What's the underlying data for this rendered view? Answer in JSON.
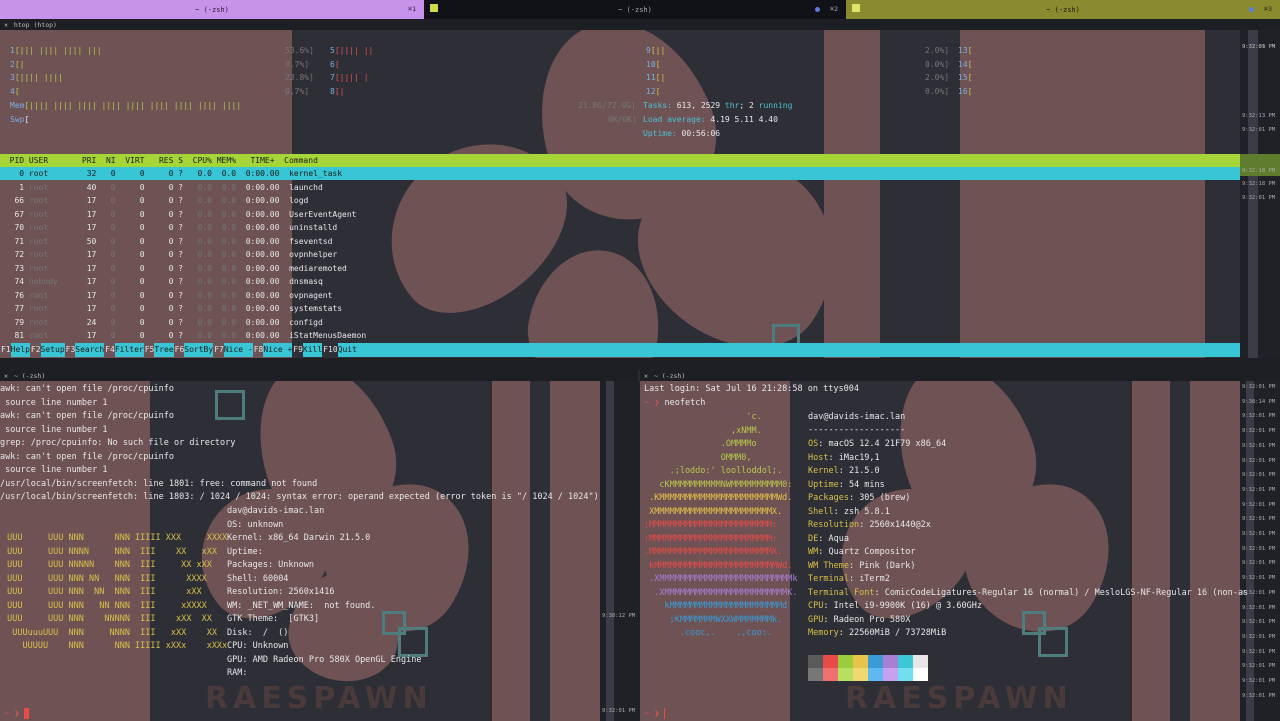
{
  "tabs": [
    {
      "title": "~ (-zsh)",
      "shortcut": "⌘1",
      "color": "#c792ea"
    },
    {
      "title": "~ (-zsh)",
      "shortcut": "⌘2",
      "color": "#111217"
    },
    {
      "title": "~ (-zsh)",
      "shortcut": "⌘3",
      "color": "#8a8a2e"
    }
  ],
  "htop": {
    "pane_title": "htop (htop)",
    "cpus_left": [
      {
        "n": "1",
        "bar": "[||| |||| |||| |||",
        "pct": "53.6"
      },
      {
        "n": "2",
        "bar": "[|",
        "pct": "0.7"
      },
      {
        "n": "3",
        "bar": "[|||| ||||",
        "pct": "23.8"
      },
      {
        "n": "4",
        "bar": "[",
        "pct": "0.7"
      }
    ],
    "cpus_mid": [
      {
        "n": "5",
        "bar": "[|||| ||"
      },
      {
        "n": "6",
        "bar": "["
      },
      {
        "n": "7",
        "bar": "[|||| |"
      },
      {
        "n": "8",
        "bar": "[|"
      }
    ],
    "cpus_mid2": [
      {
        "n": "9",
        "bar": "[||",
        "pct": "2.0"
      },
      {
        "n": "10",
        "bar": "[",
        "pct": "0.0"
      },
      {
        "n": "11",
        "bar": "[|",
        "pct": "2.0"
      },
      {
        "n": "12",
        "bar": "[",
        "pct": "0.0"
      }
    ],
    "cpus_right": [
      {
        "n": "13",
        "bar": "["
      },
      {
        "n": "14",
        "bar": "["
      },
      {
        "n": "15",
        "bar": "["
      },
      {
        "n": "16",
        "bar": "["
      }
    ],
    "mem_label": "Mem",
    "mem_bar": "[|||| |||| |||| |||| |||| |||| |||| |||| ||||",
    "mem_val": "21.8G/72.0G]",
    "swp_label": "Swp",
    "swp_bar": "[",
    "swp_val": "0K/0K]",
    "tasks_label": "Tasks:",
    "tasks_count": "613",
    "threads": "2529",
    "thr_label": "thr",
    "running": "2",
    "running_label": "running",
    "load_label": "Load average:",
    "load1": "4.19",
    "load5": "5.11",
    "load15": "4.40",
    "uptime_label": "Uptime:",
    "uptime": "00:56:06",
    "columns": "  PID USER       PRI  NI  VIRT   RES S  CPU% MEM%   TIME+  Command",
    "processes": [
      {
        "pid": "0",
        "user": "root",
        "pri": "32",
        "ni": "0",
        "virt": "0",
        "res": "0",
        "s": "?",
        "cpu": "0.0",
        "mem": "0.0",
        "time": "0:00.00",
        "cmd": "kernel_task"
      },
      {
        "pid": "1",
        "user": "root",
        "pri": "40",
        "ni": "0",
        "virt": "0",
        "res": "0",
        "s": "?",
        "cpu": "0.0",
        "mem": "0.0",
        "time": "0:00.00",
        "cmd": "launchd"
      },
      {
        "pid": "66",
        "user": "root",
        "pri": "17",
        "ni": "0",
        "virt": "0",
        "res": "0",
        "s": "?",
        "cpu": "0.0",
        "mem": "0.0",
        "time": "0:00.00",
        "cmd": "logd"
      },
      {
        "pid": "67",
        "user": "root",
        "pri": "17",
        "ni": "0",
        "virt": "0",
        "res": "0",
        "s": "?",
        "cpu": "0.0",
        "mem": "0.0",
        "time": "0:00.00",
        "cmd": "UserEventAgent"
      },
      {
        "pid": "70",
        "user": "root",
        "pri": "17",
        "ni": "0",
        "virt": "0",
        "res": "0",
        "s": "?",
        "cpu": "0.0",
        "mem": "0.0",
        "time": "0:00.00",
        "cmd": "uninstalld"
      },
      {
        "pid": "71",
        "user": "root",
        "pri": "50",
        "ni": "0",
        "virt": "0",
        "res": "0",
        "s": "?",
        "cpu": "0.0",
        "mem": "0.0",
        "time": "0:00.00",
        "cmd": "fseventsd"
      },
      {
        "pid": "72",
        "user": "root",
        "pri": "17",
        "ni": "0",
        "virt": "0",
        "res": "0",
        "s": "?",
        "cpu": "0.0",
        "mem": "0.0",
        "time": "0:00.00",
        "cmd": "ovpnhelper"
      },
      {
        "pid": "73",
        "user": "root",
        "pri": "17",
        "ni": "0",
        "virt": "0",
        "res": "0",
        "s": "?",
        "cpu": "0.0",
        "mem": "0.0",
        "time": "0:00.00",
        "cmd": "mediaremoted"
      },
      {
        "pid": "74",
        "user": "nobody",
        "pri": "17",
        "ni": "0",
        "virt": "0",
        "res": "0",
        "s": "?",
        "cpu": "0.0",
        "mem": "0.0",
        "time": "0:00.00",
        "cmd": "dnsmasq"
      },
      {
        "pid": "76",
        "user": "root",
        "pri": "17",
        "ni": "0",
        "virt": "0",
        "res": "0",
        "s": "?",
        "cpu": "0.0",
        "mem": "0.0",
        "time": "0:00.00",
        "cmd": "ovpnagent"
      },
      {
        "pid": "77",
        "user": "root",
        "pri": "17",
        "ni": "0",
        "virt": "0",
        "res": "0",
        "s": "?",
        "cpu": "0.0",
        "mem": "0.0",
        "time": "0:00.00",
        "cmd": "systemstats"
      },
      {
        "pid": "79",
        "user": "root",
        "pri": "24",
        "ni": "0",
        "virt": "0",
        "res": "0",
        "s": "?",
        "cpu": "0.0",
        "mem": "0.0",
        "time": "0:00.00",
        "cmd": "configd"
      },
      {
        "pid": "81",
        "user": "root",
        "pri": "17",
        "ni": "0",
        "virt": "0",
        "res": "0",
        "s": "?",
        "cpu": "0.0",
        "mem": "0.0",
        "time": "0:00.00",
        "cmd": "iStatMenusDaemon"
      }
    ],
    "fkeys": [
      {
        "k": "F1",
        "l": "Help  "
      },
      {
        "k": "F2",
        "l": "Setup "
      },
      {
        "k": "F3",
        "l": "Search"
      },
      {
        "k": "F4",
        "l": "Filter"
      },
      {
        "k": "F5",
        "l": "Tree  "
      },
      {
        "k": "F6",
        "l": "SortBy"
      },
      {
        "k": "F7",
        "l": "Nice -"
      },
      {
        "k": "F8",
        "l": "Nice +"
      },
      {
        "k": "F9",
        "l": "Kill  "
      },
      {
        "k": "F10",
        "l": "Quit  "
      }
    ],
    "timestamps": [
      "9:32:01 PM",
      "9:37:39 PM",
      "9:32:13 PM",
      "9:32:01 PM",
      "9:32:18 PM",
      "9:32:18 PM",
      "9:32:01 PM"
    ]
  },
  "left_pane": {
    "title": "~ (-zsh)",
    "errors": [
      "awk: can't open file /proc/cpuinfo",
      " source line number 1",
      "awk: can't open file /proc/cpuinfo",
      " source line number 1",
      "grep: /proc/cpuinfo: No such file or directory",
      "awk: can't open file /proc/cpuinfo",
      " source line number 1",
      "/usr/local/bin/screenfetch: line 1801: free: command not found",
      "/usr/local/bin/screenfetch: line 1803: / 1024 / 1024: syntax error: operand expected (error token is \"/ 1024 / 1024\")"
    ],
    "logo": [
      "",
      "",
      " UUU     UUU NNN      NNN IIIII XXX     XXXX",
      " UUU     UUU NNNN     NNN  III    XX   xXX",
      " UUU     UUU NNNNN    NNN  III     XX xXX",
      " UUU     UUU NNN NN   NNN  III      XXXX",
      " UUU     UUU NNN  NN  NNN  III      xXX",
      " UUU     UUU NNN   NN NNN  III     xXXXX",
      " UUU     UUU NNN    NNNNN  III    xXX  XX",
      "  UUUuuuUUU  NNN     NNNN  III   xXX    XX",
      "    UUUUU    NNN      NNN IIIII xXXx    xXXx",
      ""
    ],
    "info": [
      {
        "k": "",
        "v": "dav@davids-imac.lan"
      },
      {
        "k": "OS:",
        "v": " unknown"
      },
      {
        "k": "Kernel:",
        "v": " x86_64 Darwin 21.5.0"
      },
      {
        "k": "Uptime:",
        "v": ""
      },
      {
        "k": "Packages:",
        "v": " Unknown"
      },
      {
        "k": "Shell:",
        "v": " 60004"
      },
      {
        "k": "Resolution:",
        "v": " 2560x1416"
      },
      {
        "k": "WM:",
        "v": " _NET_WM_NAME:  not found."
      },
      {
        "k": "GTK Theme:",
        "v": "  [GTK3]"
      },
      {
        "k": "Disk:",
        "v": "  /  ()"
      },
      {
        "k": "CPU:",
        "v": " Unknown"
      },
      {
        "k": "GPU:",
        "v": " AMD Radeon Pro 580X OpenGL Engine"
      },
      {
        "k": "RAM:",
        "v": ""
      }
    ],
    "prompt": "~ ❯",
    "timestamps": [
      "9:38:12 PM",
      "9:32:01 PM"
    ]
  },
  "right_pane": {
    "title": "~ (-zsh)",
    "last_login": "Last login: Sat Jul 16 21:28:58 on ttys004",
    "cmd_prompt": "~ ❯",
    "cmd": "neofetch",
    "apple": [
      "                    'c.",
      "                 ,xNMM.",
      "               .OMMMMo",
      "               OMMM0,",
      "     .;loddo:' loolloddol;.",
      "   cKMMMMMMMMMMNWMMMMMMMMMM0:",
      " .KMMMMMMMMMMMMMMMMMMMMMMMWd.",
      " XMMMMMMMMMMMMMMMMMMMMMMMX.",
      ";MMMMMMMMMMMMMMMMMMMMMMMM:",
      ":MMMMMMMMMMMMMMMMMMMMMMMM:",
      ".MMMMMMMMMMMMMMMMMMMMMMMMX.",
      " kMMMMMMMMMMMMMMMMMMMMMMMMWd.",
      " .XMMMMMMMMMMMMMMMMMMMMMMMMMMk",
      "  .XMMMMMMMMMMMMMMMMMMMMMMMMK.",
      "    kMMMMMMMMMMMMMMMMMMMMMMd",
      "     ;KMMMMMMMWXXWMMMMMMMk.",
      "       .cooc,.    .,coo:."
    ],
    "host_title": "dav@davids-imac.lan",
    "separator": "-------------------",
    "info": [
      {
        "k": "OS",
        "v": ": macOS 12.4 21F79 x86_64"
      },
      {
        "k": "Host",
        "v": ": iMac19,1"
      },
      {
        "k": "Kernel",
        "v": ": 21.5.0"
      },
      {
        "k": "Uptime",
        "v": ": 54 mins"
      },
      {
        "k": "Packages",
        "v": ": 305 (brew)"
      },
      {
        "k": "Shell",
        "v": ": zsh 5.8.1"
      },
      {
        "k": "Resolution",
        "v": ": 2560x1440@2x"
      },
      {
        "k": "DE",
        "v": ": Aqua"
      },
      {
        "k": "WM",
        "v": ": Quartz Compositor"
      },
      {
        "k": "WM Theme",
        "v": ": Pink (Dark)"
      },
      {
        "k": "Terminal",
        "v": ": iTerm2"
      },
      {
        "k": "Terminal Font",
        "v": ": ComicCodeLigatures-Regular 16 (normal) / MesloLGS-NF-Regular 16 (non-as"
      },
      {
        "k": "CPU",
        "v": ": Intel i9-9900K (16) @ 3.60GHz"
      },
      {
        "k": "GPU",
        "v": ": Radeon Pro 580X"
      },
      {
        "k": "Memory",
        "v": ": 22560MiB / 73728MiB"
      }
    ],
    "palette_top": [
      "#5a5a5a",
      "#e84a4a",
      "#9ccc3c",
      "#e6c34a",
      "#3b9bd6",
      "#a97fd4",
      "#3cc7d6",
      "#e6e6e6"
    ],
    "palette_bottom": [
      "#777777",
      "#f07070",
      "#b8e060",
      "#f0d870",
      "#60b8f0",
      "#c8a0f0",
      "#70e0ee",
      "#ffffff"
    ],
    "prompt": "~ ❯",
    "timestamps": [
      "9:32:01 PM",
      "9:38:14 PM",
      "9:32:01 PM",
      "9:32:01 PM",
      "9:32:01 PM",
      "9:32:01 PM",
      "9:32:01 PM",
      "9:32:01 PM",
      "9:32:01 PM",
      "9:32:01 PM",
      "9:32:01 PM",
      "9:32:01 PM",
      "9:32:01 PM",
      "9:32:01 PM",
      "9:32:01 PM",
      "9:32:01 PM",
      "9:32:01 PM",
      "9:32:01 PM",
      "9:32:01 PM",
      "9:32:01 PM",
      "9:32:01 PM",
      "9:32:01 PM"
    ]
  },
  "wallpaper_text": "RAESPAWN"
}
